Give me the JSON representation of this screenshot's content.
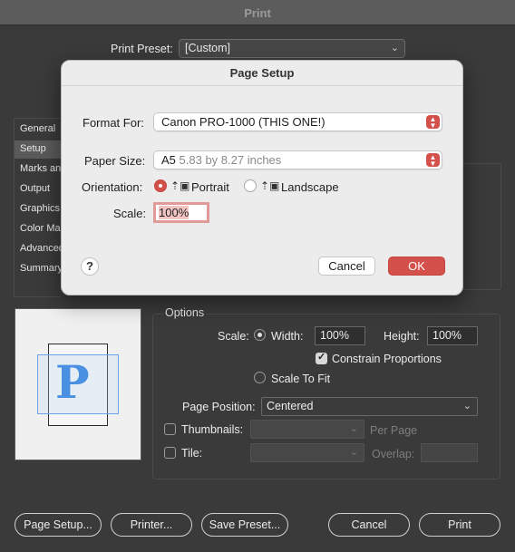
{
  "print_dialog": {
    "title": "Print",
    "preset_label": "Print Preset:",
    "preset_value": "[Custom]",
    "sidebar": [
      {
        "label": "General"
      },
      {
        "label": "Setup"
      },
      {
        "label": "Marks and Bleed"
      },
      {
        "label": "Output"
      },
      {
        "label": "Graphics"
      },
      {
        "label": "Color Management"
      },
      {
        "label": "Advanced"
      },
      {
        "label": "Summary"
      }
    ],
    "preview_glyph": "P",
    "options": {
      "section_label": "Options",
      "scale_label": "Scale:",
      "width_label": "Width:",
      "width_value": "100%",
      "height_label": "Height:",
      "height_value": "100%",
      "constrain_label": "Constrain Proportions",
      "scale_to_fit_label": "Scale To Fit",
      "page_position_label": "Page Position:",
      "page_position_value": "Centered",
      "thumbnails_label": "Thumbnails:",
      "per_page_label": "Per Page",
      "tile_label": "Tile:",
      "overlap_label": "Overlap:"
    },
    "buttons": {
      "page_setup": "Page Setup...",
      "printer": "Printer...",
      "save_preset": "Save Preset...",
      "cancel": "Cancel",
      "print": "Print"
    }
  },
  "page_setup": {
    "title": "Page Setup",
    "format_label": "Format For:",
    "format_value": "Canon PRO-1000 (THIS ONE!)",
    "paper_label": "Paper Size:",
    "paper_value": "A5",
    "paper_detail": "5.83 by 8.27 inches",
    "orientation_label": "Orientation:",
    "portrait_label": "Portrait",
    "landscape_label": "Landscape",
    "scale_label": "Scale:",
    "scale_value": "100%",
    "help_label": "?",
    "cancel_label": "Cancel",
    "ok_label": "OK"
  },
  "colors": {
    "accent": "#d4504a",
    "dialog_bg": "#ececec",
    "window_bg": "#3a3a3a",
    "preview_blue": "#4a90e2"
  }
}
